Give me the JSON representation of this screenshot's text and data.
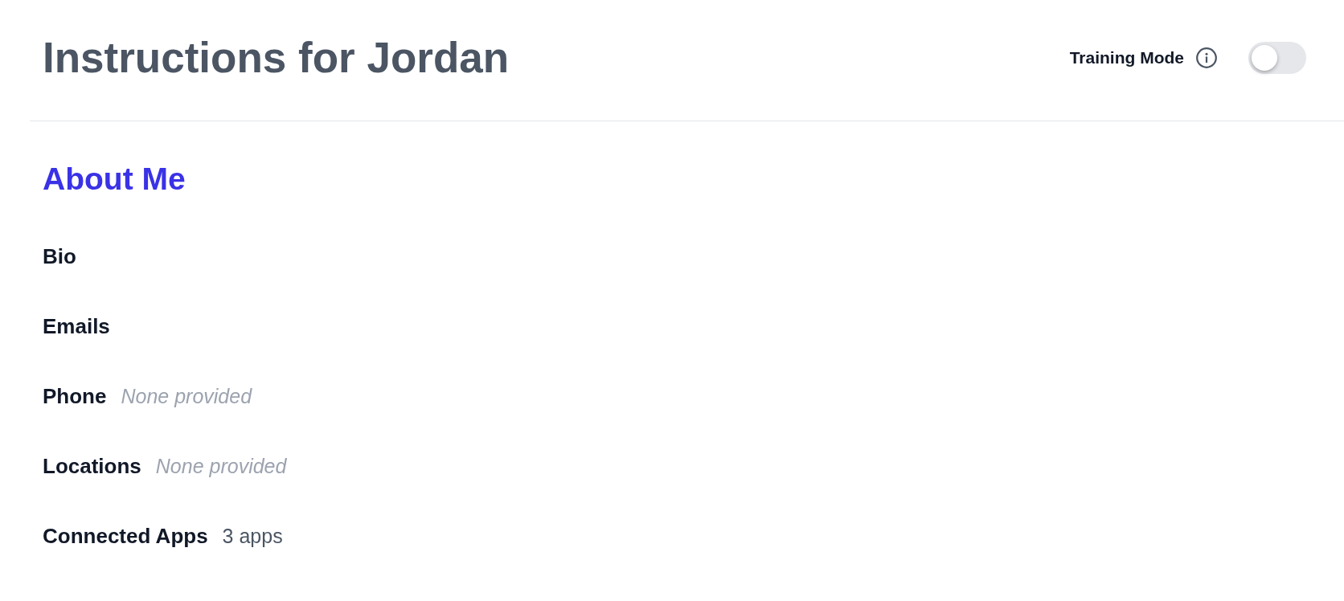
{
  "header": {
    "title": "Instructions for Jordan",
    "training_mode": {
      "label": "Training Mode",
      "on": false
    }
  },
  "section": {
    "title": "About Me",
    "fields": [
      {
        "label": "Bio"
      },
      {
        "label": "Emails"
      },
      {
        "label": "Phone",
        "value": "None provided",
        "kind": "empty"
      },
      {
        "label": "Locations",
        "value": "None provided",
        "kind": "empty"
      },
      {
        "label": "Connected Apps",
        "value": "3 apps",
        "kind": "text"
      }
    ]
  }
}
